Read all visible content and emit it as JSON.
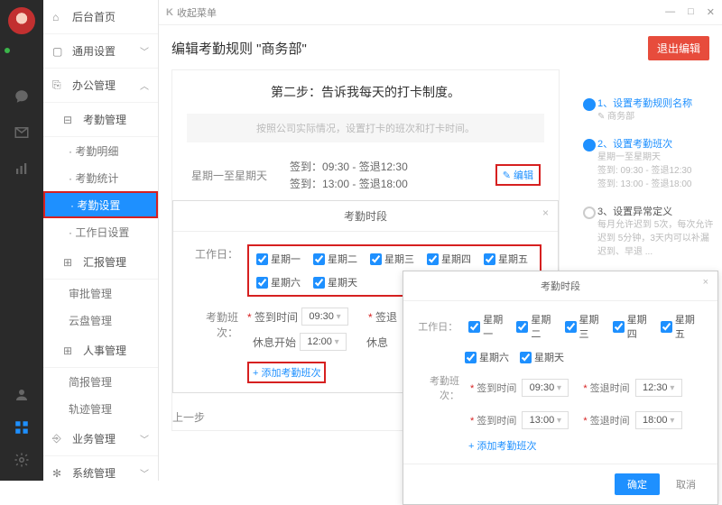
{
  "topbar": {
    "back": "收起菜单",
    "k": "K"
  },
  "sidebar": {
    "home": "后台首页",
    "general": "通用设置",
    "office": "办公管理",
    "attendance": "考勤管理",
    "sub": {
      "detail": "· 考勤明细",
      "stats": "· 考勤统计",
      "settings": "· 考勤设置",
      "workday": "· 工作日设置"
    },
    "report": "汇报管理",
    "approval": "审批管理",
    "cloud": "云盘管理",
    "hr": "人事管理",
    "brief": "简报管理",
    "track": "轨迹管理",
    "business": "业务管理",
    "system": "系统管理"
  },
  "page": {
    "title": "编辑考勤规则 \"商务部\"",
    "exit": "退出编辑"
  },
  "steps": {
    "s1": {
      "t": "1、设置考勤规则名称",
      "sub": "✎ 商务部"
    },
    "s2": {
      "t": "2、设置考勤班次",
      "sub1": "星期一至星期天",
      "sub2": "签到: 09:30 - 签退12:30",
      "sub3": "签到: 13:00 - 签退18:00"
    },
    "s3": {
      "t": "3、设置异常定义",
      "sub": "每月允许迟到 5次，每次允许迟到 5分钟，3天内可以补漏",
      "sub2": "迟到、早退 ..."
    }
  },
  "content": {
    "stepTitle": "第二步：告诉我每天的打卡制度。",
    "hint": "按照公司实际情况，设置打卡的班次和打卡时间。",
    "rangeLabel": "星期一至星期天",
    "line1": "签到：09:30 - 签退12:30",
    "line2": "签到：13:00 - 签退18:00",
    "edit": "编辑",
    "prev": "上一步"
  },
  "modal": {
    "title": "考勤时段",
    "workdayLabel": "工作日：",
    "days": [
      "星期一",
      "星期二",
      "星期三",
      "星期四",
      "星期五",
      "星期六",
      "星期天"
    ],
    "shiftLabel": "考勤班次：",
    "signIn": "签到时间",
    "restStart": "休息开始",
    "signOut": "签退",
    "rest": "休息",
    "t1": "09:30",
    "t2": "12:00",
    "add": "+ 添加考勤班次"
  },
  "modal2": {
    "title": "考勤时段",
    "workdayLabel": "工作日：",
    "shiftLabel": "考勤班次：",
    "signIn": "签到时间",
    "signOut": "签退时间",
    "t1": "09:30",
    "t2": "12:30",
    "t3": "13:00",
    "t4": "18:00",
    "add": "+ 添加考勤班次",
    "ok": "确定",
    "cancel": "取消"
  }
}
